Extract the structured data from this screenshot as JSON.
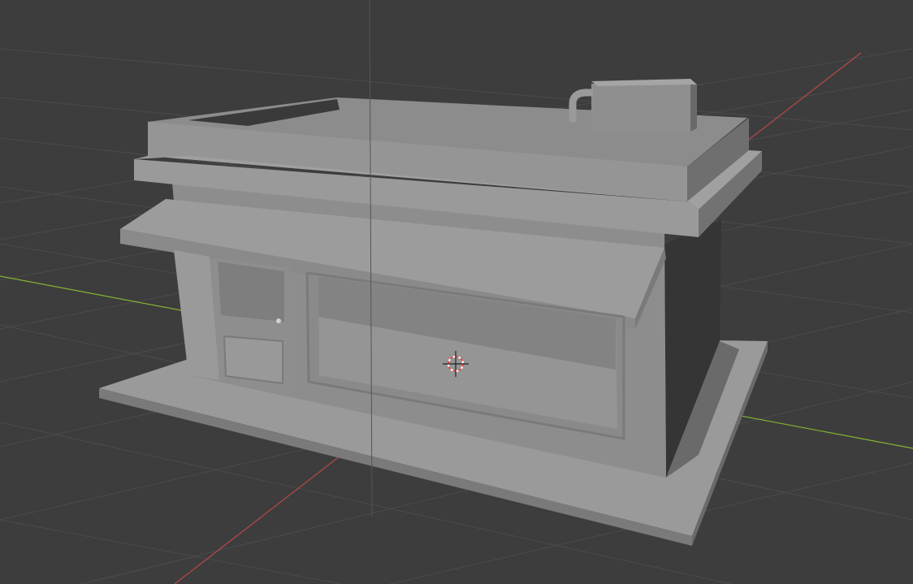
{
  "viewport": {
    "mode": "solid-shading",
    "background_color": "#3d3d3d",
    "grid_line_color": "#4a4a4a",
    "x_axis_color": "#c14848",
    "y_axis_color": "#83b432",
    "z_axis_color": "#5a5a5a"
  },
  "scene": {
    "objects": [
      "shop-building",
      "ground-slab",
      "rooftop-ac-unit",
      "front-door",
      "shop-window",
      "awning"
    ],
    "cursor_icon": "3d-cursor-icon"
  }
}
